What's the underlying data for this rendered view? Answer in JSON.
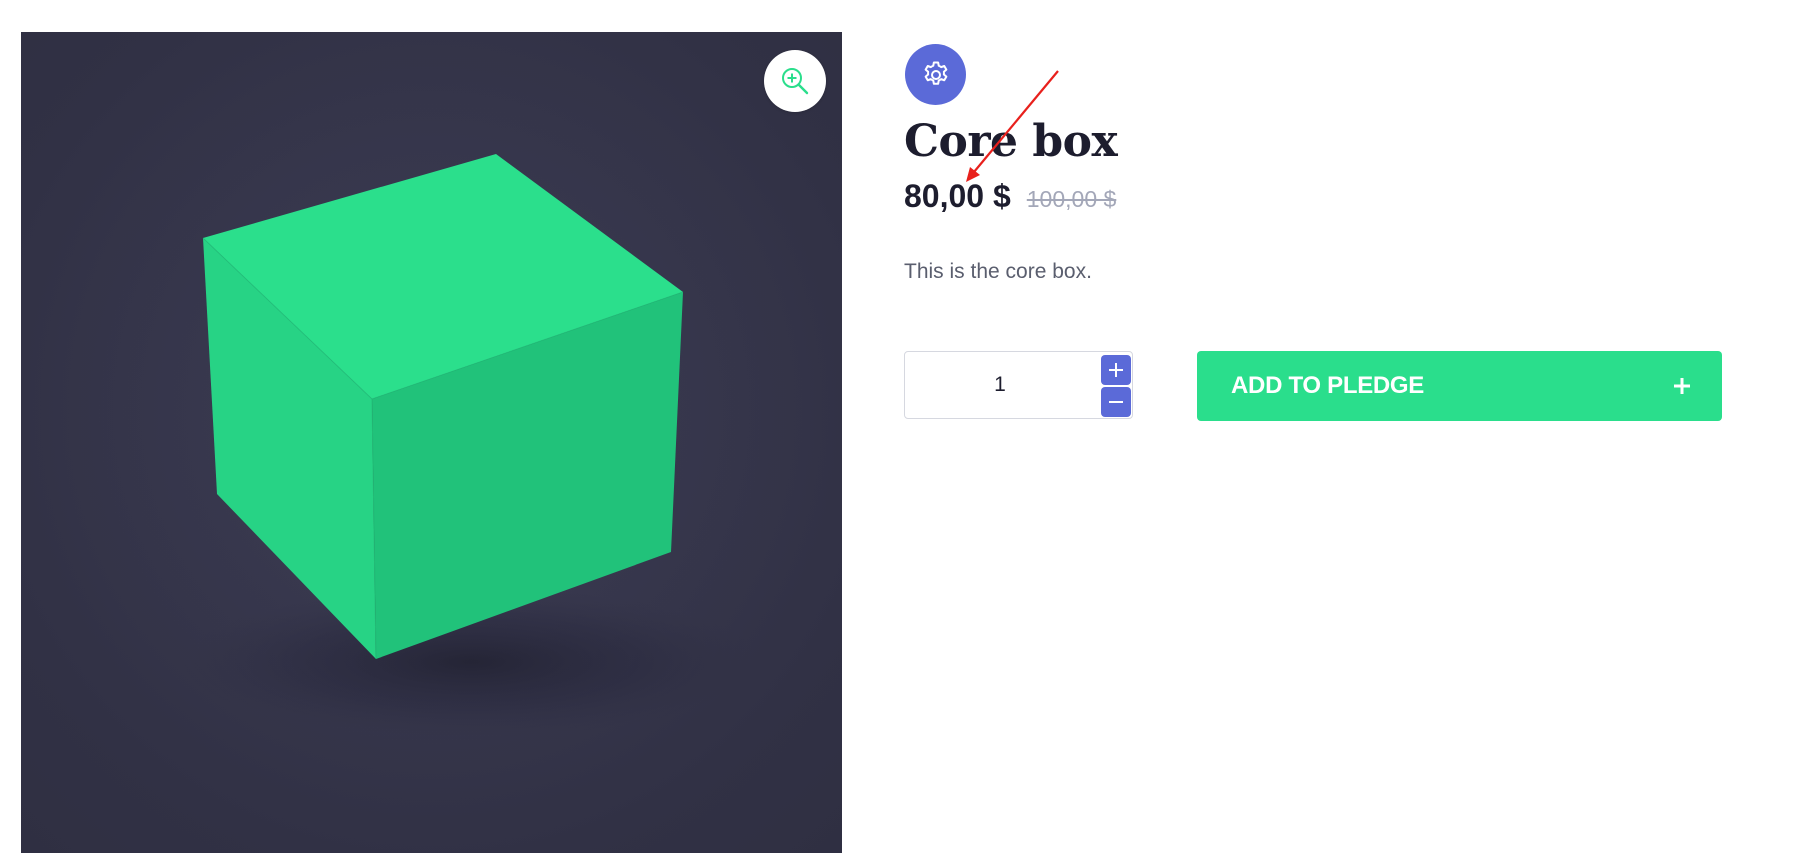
{
  "product": {
    "title": "Core box",
    "price": "80,00 $",
    "old_price": "100,00 $",
    "description": "This is the core box.",
    "image_alt_icon": "green-cube"
  },
  "image_panel": {
    "zoom_icon": "zoom-in-icon"
  },
  "badge": {
    "icon": "gear-icon"
  },
  "quantity": {
    "value": "1",
    "increment_icon": "plus-icon",
    "decrement_icon": "minus-icon"
  },
  "actions": {
    "add_label": "ADD TO PLEDGE",
    "add_icon": "plus-icon"
  },
  "colors": {
    "accent_green": "#2ade8c",
    "accent_blue": "#5b6ad8",
    "image_background": "#36364b",
    "annotation_red": "#e8201c"
  }
}
